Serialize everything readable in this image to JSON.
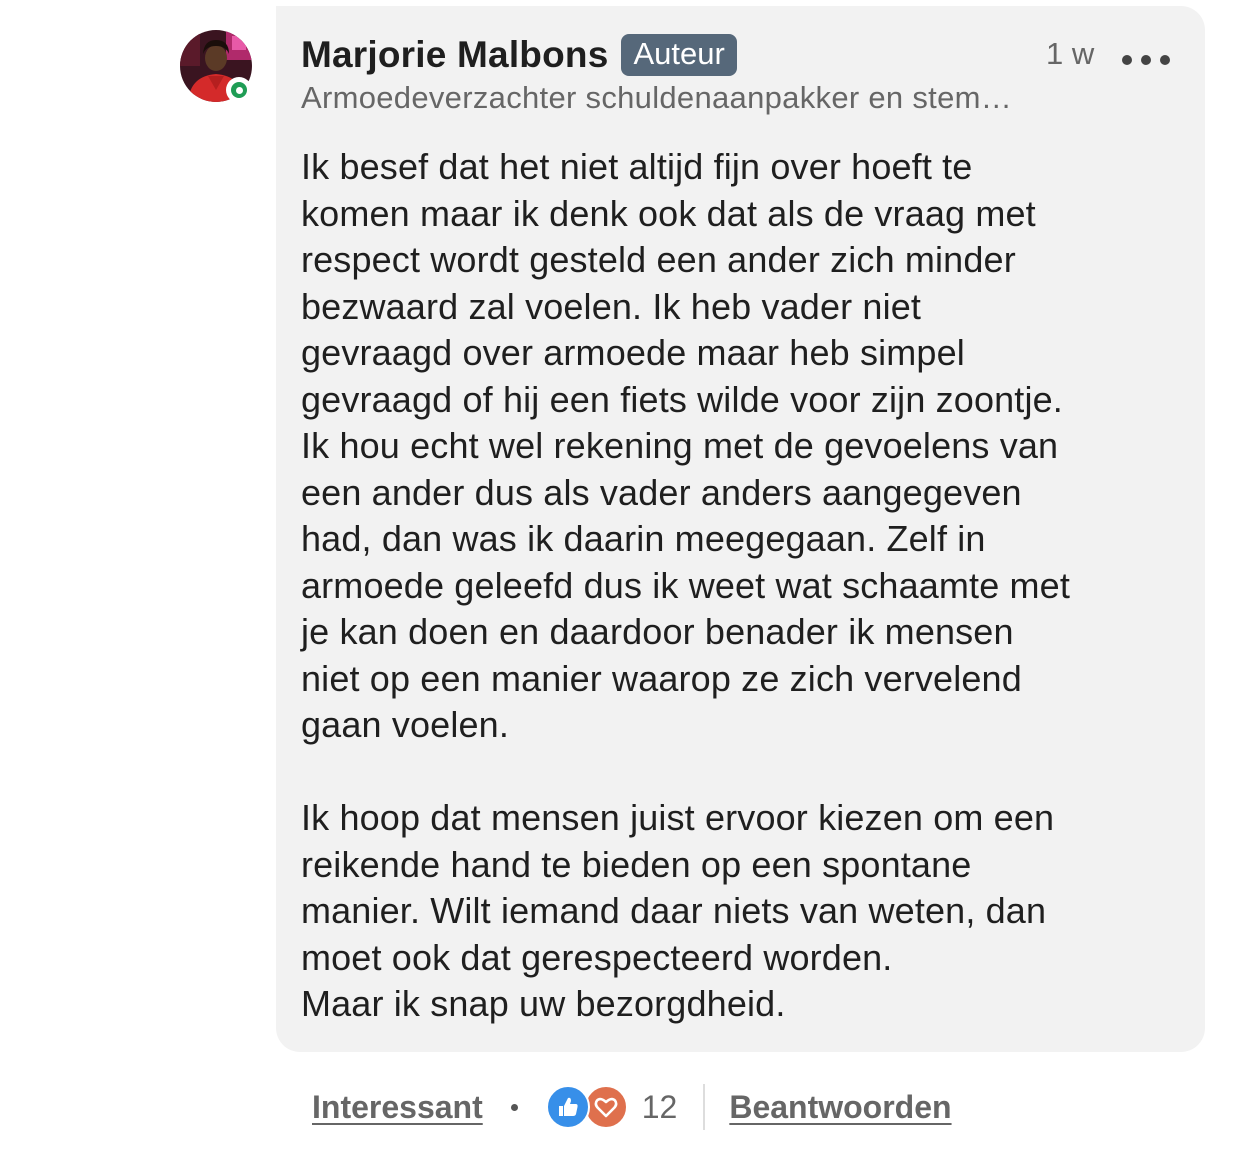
{
  "comment": {
    "author": {
      "name": "Marjorie Malbons",
      "badge": "Auteur",
      "headline": "Armoedeverzachter schuldenaanpakker en stem…",
      "online": true
    },
    "timestamp": "1 w",
    "body_paragraphs": [
      "Ik besef dat het niet altijd fijn over hoeft te\nkomen maar ik denk ook dat als de vraag met\nrespect wordt gesteld een ander zich minder\nbezwaard zal voelen. Ik heb vader niet\ngevraagd over armoede maar heb simpel\ngevraagd of hij een fiets wilde voor zijn zoontje.\nIk hou echt wel rekening met de gevoelens van\neen ander dus als vader anders aangegeven\nhad, dan was ik daarin meegegaan. Zelf in\narmoede geleefd dus ik weet wat schaamte met\nje kan doen en daardoor benader ik mensen\nniet op een manier waarop ze zich vervelend\ngaan voelen.",
      "Ik hoop dat mensen juist ervoor kiezen om een\nreikende hand te bieden op een spontane\nmanier. Wilt iemand daar niets van weten, dan\nmoet ook dat gerespecteerd worden.\nMaar ik snap uw bezorgdheid."
    ]
  },
  "actions": {
    "react_label": "Interessant",
    "reaction_count": "12",
    "reaction_icons": [
      "like-icon",
      "love-icon"
    ],
    "reply_label": "Beantwoorden"
  },
  "colors": {
    "bubble_bg": "#f2f2f2",
    "badge_bg": "#56687a",
    "like_blue": "#378fe9",
    "love_orange": "#df704d",
    "online_green": "#1f9d55"
  }
}
